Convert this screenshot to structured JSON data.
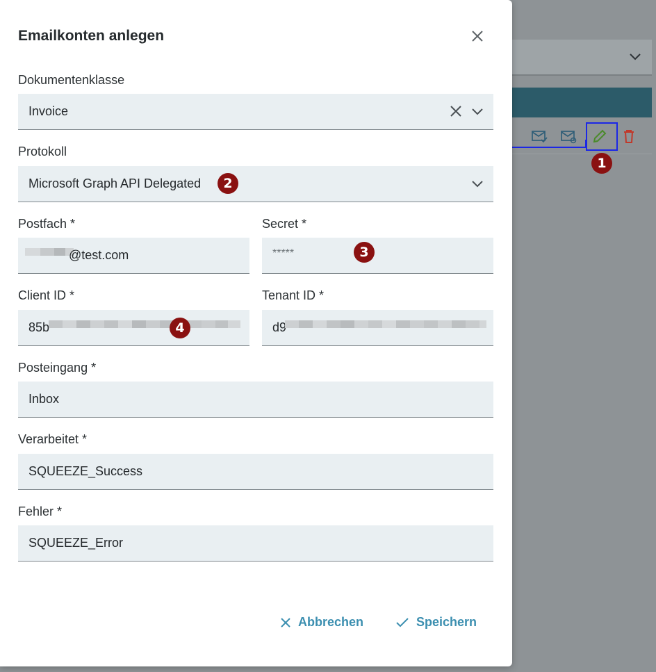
{
  "dialog": {
    "title": "Emailkonten anlegen",
    "fields": {
      "document_class": {
        "label": "Dokumentenklasse",
        "value": "Invoice"
      },
      "protocol": {
        "label": "Protokoll",
        "value": "Microsoft Graph API Delegated"
      },
      "mailbox": {
        "label": "Postfach *",
        "value": "@test.com"
      },
      "secret": {
        "label": "Secret *",
        "value": "*****"
      },
      "client_id": {
        "label": "Client ID *",
        "value": "85b"
      },
      "tenant_id": {
        "label": "Tenant ID *",
        "value": "d9"
      },
      "inbox": {
        "label": "Posteingang *",
        "value": "Inbox"
      },
      "processed": {
        "label": "Verarbeitet *",
        "value": "SQUEEZE_Success"
      },
      "error": {
        "label": "Fehler *",
        "value": "SQUEEZE_Error"
      }
    },
    "buttons": {
      "cancel": "Abbrechen",
      "save": "Speichern"
    }
  },
  "annotations": {
    "badge1": "1",
    "badge2": "2",
    "badge3": "3",
    "badge4": "4"
  },
  "colors": {
    "accent": "#3c8fb0",
    "badge": "#8a1111",
    "highlight": "#1b27e6",
    "edit_icon": "#4b8a2b",
    "delete_icon": "#c0392b",
    "field_bg": "#e9eff2"
  },
  "icons": {
    "close": "close-icon",
    "clear": "clear-icon",
    "chevron": "chevron-down-icon",
    "mail_check": "mail-check-icon",
    "mail_sync": "mail-sync-icon",
    "edit": "pencil-icon",
    "delete": "trash-icon"
  }
}
